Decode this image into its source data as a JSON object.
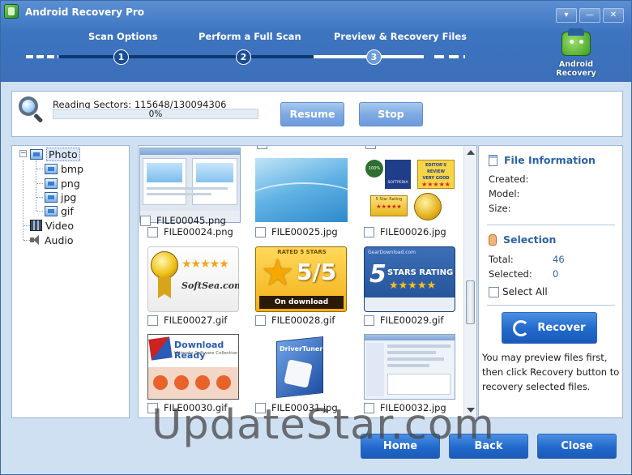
{
  "window": {
    "title": "Android Recovery Pro",
    "buttons": [
      "▾",
      "—",
      "✕"
    ]
  },
  "wizard": {
    "steps": [
      {
        "number": "1",
        "label": "Scan Options",
        "state": "done"
      },
      {
        "number": "2",
        "label": "Perform a Full Scan",
        "state": "done"
      },
      {
        "number": "3",
        "label": "Preview & Recovery Files",
        "state": "current"
      }
    ],
    "logo_line1": "Android",
    "logo_line2": "Recovery"
  },
  "scan": {
    "status": "Reading Sectors: 115648/130094306",
    "percent_text": "0%",
    "progress_fraction": 0.0,
    "resume_label": "Resume",
    "stop_label": "Stop"
  },
  "tree": {
    "photo": "Photo",
    "photo_children": [
      "bmp",
      "png",
      "jpg",
      "gif"
    ],
    "video": "Video",
    "audio": "Audio"
  },
  "files": {
    "partial_top": "FILE00045.png",
    "row1": [
      "FILE00024.png",
      "FILE00025.jpg",
      "FILE00026.jpg"
    ],
    "row2": [
      "FILE00027.gif",
      "FILE00028.gif",
      "FILE00029.gif"
    ],
    "row3": [
      "FILE00030.gif",
      "FILE00031.jpg",
      "FILE00032.jpg"
    ],
    "thumb_texts": {
      "softpedia_1": "100% FREE",
      "softpedia_2": "SOFTPEDIA",
      "editors_review": "EDITOR'S REVIEW",
      "very_good": "VERY GOOD",
      "five_star_rating": "5 Star Rating",
      "softsea": "SoftSea.com",
      "rated_5_stars": "RATED 5 STARS",
      "five_of_five": "5/5",
      "on_download": "On download",
      "geardownload": "GearDownload.com",
      "stars_rating": "STARS RATING",
      "download_ready": "Download Ready",
      "download_ready_sub": "Ultimate Software Collection",
      "driver_tuner": "DriverTuner"
    }
  },
  "right_panel": {
    "info_title": "File Information",
    "created_label": "Created:",
    "model_label": "Model:",
    "size_label": "Size:",
    "selection_title": "Selection",
    "total_label": "Total:",
    "total_value": "46",
    "selected_label": "Selected:",
    "selected_value": "0",
    "select_all_label": "Select All",
    "recover_label": "Recover",
    "note": "You may preview files first, then click Recovery button to recovery selected files."
  },
  "footer": {
    "home_label": "Home",
    "back_label": "Back",
    "close_label": "Close"
  },
  "watermark": "UpdateStar.com",
  "colors": {
    "header_blue": "#3d74c0",
    "accent_blue": "#2169cc",
    "panel_border": "#9db7d8"
  }
}
